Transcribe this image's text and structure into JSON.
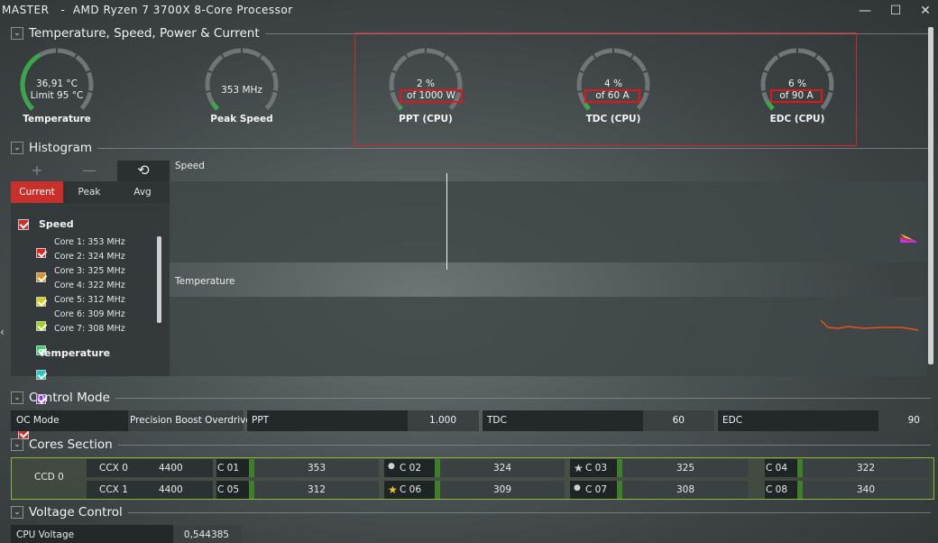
{
  "window": {
    "title": "MASTER   -  AMD Ryzen 7 3700X 8-Core Processor",
    "min": "—",
    "max": "☐",
    "close": "✕"
  },
  "sections": {
    "temp": "Temperature, Speed, Power & Current",
    "histogram": "Histogram",
    "control": "Control Mode",
    "cores": "Cores Section",
    "voltage": "Voltage Control"
  },
  "gauges": [
    {
      "value": "36,91 °C",
      "sub": "Limit 95 °C",
      "label": "Temperature",
      "fill": 0.39,
      "color": "#3aa84a"
    },
    {
      "value": "353  MHz",
      "sub": "",
      "label": "Peak Speed",
      "fill": 0.05,
      "color": "#3aa84a"
    },
    {
      "value": "2 %",
      "sub": "of 1000 W",
      "label": "PPT (CPU)",
      "fill": 0.02,
      "color": "#3aa84a"
    },
    {
      "value": "4 %",
      "sub": "of 60 A",
      "label": "TDC (CPU)",
      "fill": 0.04,
      "color": "#3aa84a"
    },
    {
      "value": "6 %",
      "sub": "of 90 A",
      "label": "EDC (CPU)",
      "fill": 0.06,
      "color": "#3aa84a"
    }
  ],
  "histogram": {
    "tools": {
      "add": "+",
      "remove": "—",
      "reset": "⟲"
    },
    "tabs": [
      "Current",
      "Peak",
      "Avg"
    ],
    "speed_group": "Speed",
    "temp_group": "Temperature",
    "cores": [
      {
        "label": "Core 1: 353 MHz",
        "color": "#e02525"
      },
      {
        "label": "Core 2: 324 MHz",
        "color": "#e0911c"
      },
      {
        "label": "Core 3: 325 MHz",
        "color": "#d8cf1c"
      },
      {
        "label": "Core 4: 322 MHz",
        "color": "#9ed41c"
      },
      {
        "label": "Core 5: 312 MHz",
        "color": "#2fd46a"
      },
      {
        "label": "Core 6: 309 MHz",
        "color": "#1cc9c2"
      },
      {
        "label": "Core 7: 308 MHz",
        "color": "#8a3ae0"
      }
    ],
    "chart_speed": "Speed",
    "chart_temp": "Temperature"
  },
  "control": {
    "oc_label": "OC Mode",
    "oc_value": "Precision Boost Overdrive",
    "ppt_label": "PPT",
    "ppt_value": "1.000",
    "tdc_label": "TDC",
    "tdc_value": "60",
    "edc_label": "EDC",
    "edc_value": "90"
  },
  "cores": {
    "ccd": "CCD 0",
    "rows": [
      {
        "ccx": "CCX 0",
        "freq": "4400",
        "cores": [
          {
            "name": "C 01",
            "mark": "",
            "value": "353"
          },
          {
            "name": "C 02",
            "mark": "●",
            "value": "324"
          },
          {
            "name": "C 03",
            "mark": "★",
            "value": "325"
          },
          {
            "name": "C 04",
            "mark": "",
            "value": "322"
          }
        ]
      },
      {
        "ccx": "CCX 1",
        "freq": "4400",
        "cores": [
          {
            "name": "C 05",
            "mark": "",
            "value": "312"
          },
          {
            "name": "C 06",
            "mark": "★",
            "value": "309"
          },
          {
            "name": "C 07",
            "mark": "●",
            "value": "308"
          },
          {
            "name": "C 08",
            "mark": "",
            "value": "340"
          }
        ]
      }
    ]
  },
  "voltage": {
    "label": "CPU Voltage",
    "value": "0,544385"
  },
  "colors": {
    "accent_red": "#c9302c",
    "gauge_green": "#3aa84a",
    "highlight_red": "#e0161b",
    "ccd_border": "#8ab73a"
  }
}
